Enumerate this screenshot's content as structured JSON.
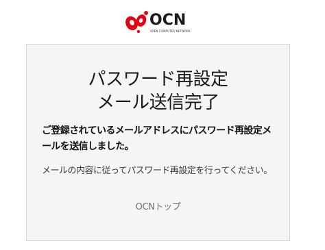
{
  "logo": {
    "wordmark": "OCN",
    "tagline": "OPEN COMPUTER NETWORK",
    "brand_color": "#e60012"
  },
  "card": {
    "title_line1": "パスワード再設定",
    "title_line2": "メール送信完了",
    "lead": "ご登録されているメールアドレスにパスワード再設定メールを送信しました。",
    "note": "メールの内容に従ってパスワード再設定を行ってください。",
    "top_link": "OCNトップ"
  }
}
